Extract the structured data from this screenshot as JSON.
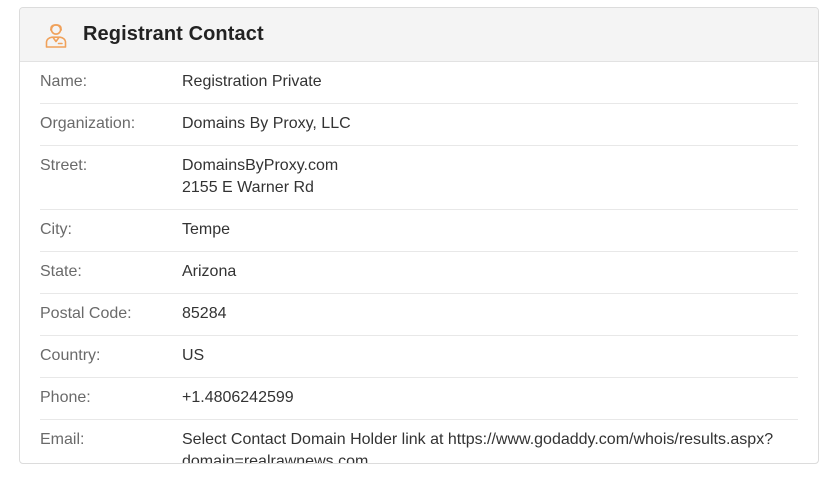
{
  "card": {
    "title": "Registrant Contact",
    "icon": "user-contact-icon",
    "accent_color": "#f0a15a"
  },
  "fields": [
    {
      "label": "Name:",
      "value": "Registration Private"
    },
    {
      "label": "Organization:",
      "value": "Domains By Proxy, LLC"
    },
    {
      "label": "Street:",
      "value": "DomainsByProxy.com\n2155 E Warner Rd"
    },
    {
      "label": "City:",
      "value": "Tempe"
    },
    {
      "label": "State:",
      "value": "Arizona"
    },
    {
      "label": "Postal Code:",
      "value": "85284"
    },
    {
      "label": "Country:",
      "value": "US"
    },
    {
      "label": "Phone:",
      "value": "+1.4806242599"
    },
    {
      "label": "Email:",
      "value": "Select Contact Domain Holder link at https://www.godaddy.com/whois/results.aspx?\ndomain=realrawnews.com"
    }
  ]
}
